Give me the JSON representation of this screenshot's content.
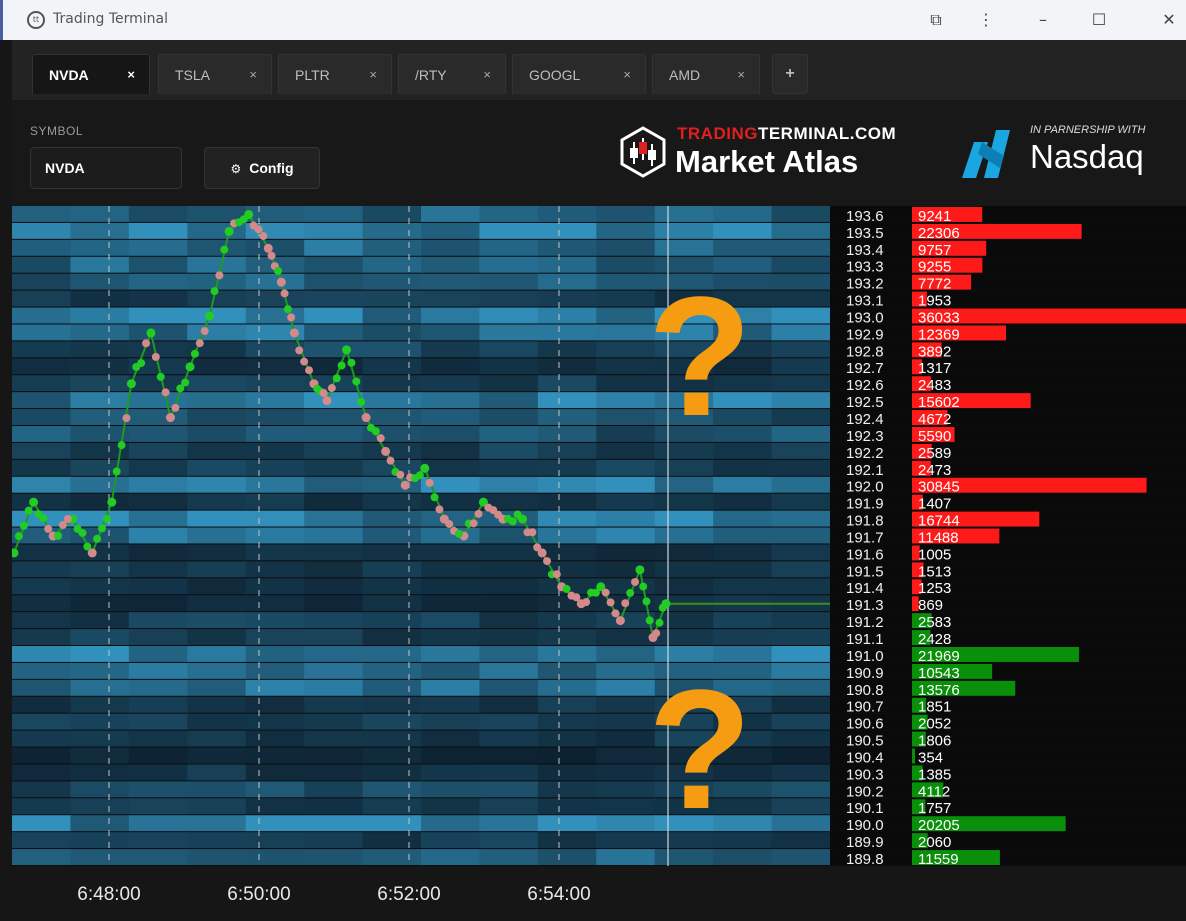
{
  "window": {
    "title": "Trading Terminal"
  },
  "tabs": [
    {
      "label": "NVDA",
      "active": true
    },
    {
      "label": "TSLA",
      "active": false
    },
    {
      "label": "PLTR",
      "active": false
    },
    {
      "label": "/RTY",
      "active": false
    },
    {
      "label": "GOOGL",
      "active": false
    },
    {
      "label": "AMD",
      "active": false
    }
  ],
  "tab_close_glyph": "×",
  "tab_add_label": "+",
  "config": {
    "symbol_label": "SYMBOL",
    "symbol_value": "NVDA",
    "config_button": "Config"
  },
  "branding": {
    "tt_red": "TRADING",
    "tt_white": "TERMINAL.COM",
    "product": "Market Atlas",
    "partner_tag": "IN PARNERSHIP WITH",
    "partner": "Nasdaq"
  },
  "overlay": {
    "unknown_mark": "?"
  },
  "colors": {
    "ask": "#ff1a1a",
    "bid": "#0a8f0a",
    "accent_question": "#f59c12",
    "heat": "#1c4a64",
    "trace_up": "#22cc22",
    "trace_down": "#d4898a"
  },
  "chart_data": {
    "type": "heatmap",
    "time_labels": [
      "6:48:00",
      "6:50:00",
      "6:52:00",
      "6:54:00"
    ],
    "current_price": 191.3,
    "price_range": [
      189.8,
      193.6
    ],
    "order_book": [
      {
        "price": "193.6",
        "size": 9241,
        "side": "ask"
      },
      {
        "price": "193.5",
        "size": 22306,
        "side": "ask"
      },
      {
        "price": "193.4",
        "size": 9757,
        "side": "ask"
      },
      {
        "price": "193.3",
        "size": 9255,
        "side": "ask"
      },
      {
        "price": "193.2",
        "size": 7772,
        "side": "ask"
      },
      {
        "price": "193.1",
        "size": 1953,
        "side": "ask"
      },
      {
        "price": "193.0",
        "size": 36033,
        "side": "ask"
      },
      {
        "price": "192.9",
        "size": 12369,
        "side": "ask"
      },
      {
        "price": "192.8",
        "size": 3892,
        "side": "ask"
      },
      {
        "price": "192.7",
        "size": 1317,
        "side": "ask"
      },
      {
        "price": "192.6",
        "size": 2483,
        "side": "ask"
      },
      {
        "price": "192.5",
        "size": 15602,
        "side": "ask"
      },
      {
        "price": "192.4",
        "size": 4672,
        "side": "ask"
      },
      {
        "price": "192.3",
        "size": 5590,
        "side": "ask"
      },
      {
        "price": "192.2",
        "size": 2589,
        "side": "ask"
      },
      {
        "price": "192.1",
        "size": 2473,
        "side": "ask"
      },
      {
        "price": "192.0",
        "size": 30845,
        "side": "ask"
      },
      {
        "price": "191.9",
        "size": 1407,
        "side": "ask"
      },
      {
        "price": "191.8",
        "size": 16744,
        "side": "ask"
      },
      {
        "price": "191.7",
        "size": 11488,
        "side": "ask"
      },
      {
        "price": "191.6",
        "size": 1005,
        "side": "ask"
      },
      {
        "price": "191.5",
        "size": 1513,
        "side": "ask"
      },
      {
        "price": "191.4",
        "size": 1253,
        "side": "ask"
      },
      {
        "price": "191.3",
        "size": 869,
        "side": "ask"
      },
      {
        "price": "191.2",
        "size": 2583,
        "side": "bid"
      },
      {
        "price": "191.1",
        "size": 2428,
        "side": "bid"
      },
      {
        "price": "191.0",
        "size": 21969,
        "side": "bid"
      },
      {
        "price": "190.9",
        "size": 10543,
        "side": "bid"
      },
      {
        "price": "190.8",
        "size": 13576,
        "side": "bid"
      },
      {
        "price": "190.7",
        "size": 1851,
        "side": "bid"
      },
      {
        "price": "190.6",
        "size": 2052,
        "side": "bid"
      },
      {
        "price": "190.5",
        "size": 1806,
        "side": "bid"
      },
      {
        "price": "190.4",
        "size": 354,
        "side": "bid"
      },
      {
        "price": "190.3",
        "size": 1385,
        "side": "bid"
      },
      {
        "price": "190.2",
        "size": 4112,
        "side": "bid"
      },
      {
        "price": "190.1",
        "size": 1757,
        "side": "bid"
      },
      {
        "price": "190.0",
        "size": 20205,
        "side": "bid"
      },
      {
        "price": "189.9",
        "size": 2060,
        "side": "bid"
      },
      {
        "price": "189.8",
        "size": 11559,
        "side": "bid"
      }
    ],
    "price_trace": [
      {
        "t": 0.0,
        "p": 191.6
      },
      {
        "t": 0.03,
        "p": 191.9
      },
      {
        "t": 0.06,
        "p": 191.7
      },
      {
        "t": 0.09,
        "p": 191.8
      },
      {
        "t": 0.12,
        "p": 191.6
      },
      {
        "t": 0.15,
        "p": 191.9
      },
      {
        "t": 0.18,
        "p": 192.6
      },
      {
        "t": 0.21,
        "p": 192.9
      },
      {
        "t": 0.24,
        "p": 192.4
      },
      {
        "t": 0.27,
        "p": 192.7
      },
      {
        "t": 0.3,
        "p": 193.0
      },
      {
        "t": 0.33,
        "p": 193.5
      },
      {
        "t": 0.36,
        "p": 193.6
      },
      {
        "t": 0.39,
        "p": 193.4
      },
      {
        "t": 0.41,
        "p": 193.2
      },
      {
        "t": 0.43,
        "p": 192.9
      },
      {
        "t": 0.46,
        "p": 192.6
      },
      {
        "t": 0.48,
        "p": 192.5
      },
      {
        "t": 0.51,
        "p": 192.8
      },
      {
        "t": 0.54,
        "p": 192.4
      },
      {
        "t": 0.57,
        "p": 192.2
      },
      {
        "t": 0.6,
        "p": 192.0
      },
      {
        "t": 0.63,
        "p": 192.1
      },
      {
        "t": 0.66,
        "p": 191.8
      },
      {
        "t": 0.69,
        "p": 191.7
      },
      {
        "t": 0.72,
        "p": 191.9
      },
      {
        "t": 0.75,
        "p": 191.8
      },
      {
        "t": 0.78,
        "p": 191.8
      },
      {
        "t": 0.81,
        "p": 191.6
      },
      {
        "t": 0.84,
        "p": 191.4
      },
      {
        "t": 0.87,
        "p": 191.3
      },
      {
        "t": 0.9,
        "p": 191.4
      },
      {
        "t": 0.93,
        "p": 191.2
      },
      {
        "t": 0.96,
        "p": 191.5
      },
      {
        "t": 0.98,
        "p": 191.1
      },
      {
        "t": 1.0,
        "p": 191.3
      }
    ]
  }
}
